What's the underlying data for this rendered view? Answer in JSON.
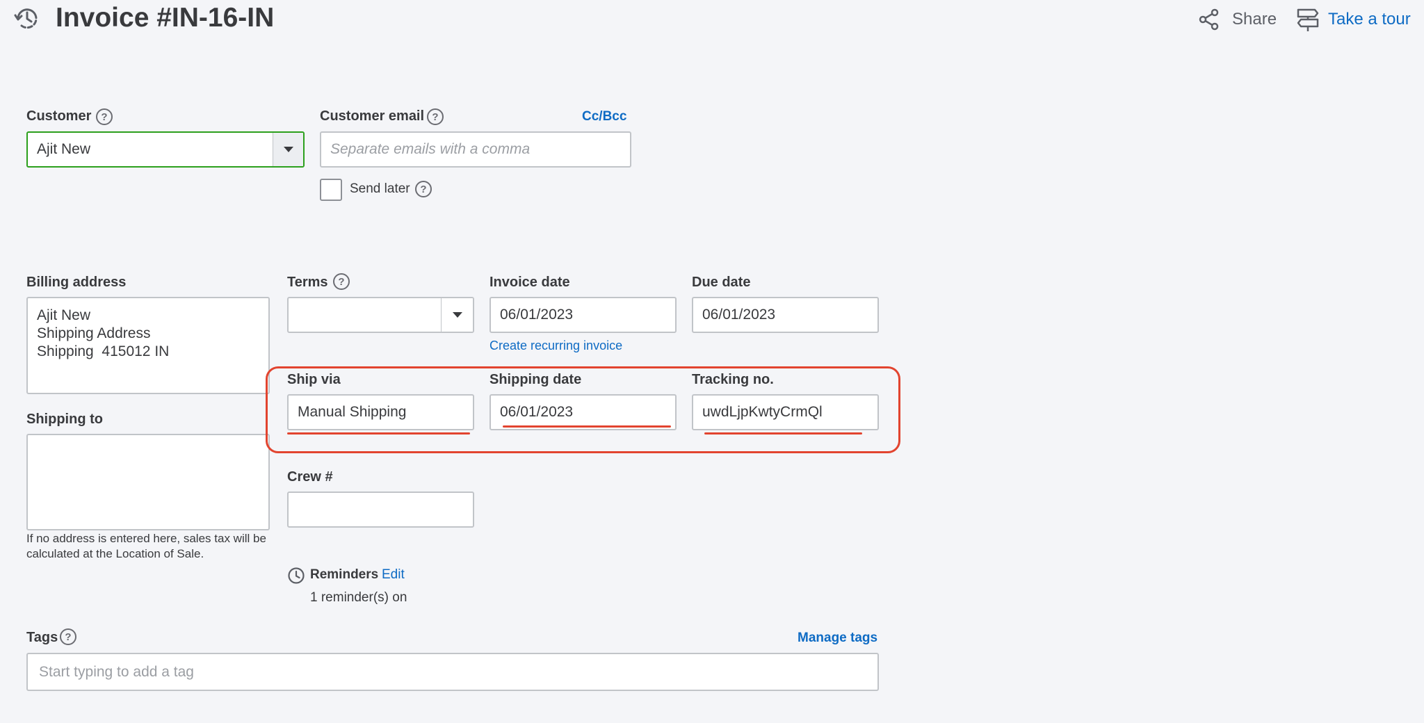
{
  "header": {
    "title": "Invoice #IN-16-IN",
    "share_label": "Share",
    "tour_label": "Take a tour"
  },
  "customer": {
    "label": "Customer",
    "value": "Ajit New"
  },
  "customer_email": {
    "label": "Customer email",
    "placeholder": "Separate emails with a comma",
    "cc_bcc": "Cc/Bcc",
    "send_later": "Send later"
  },
  "billing": {
    "label": "Billing address",
    "lines": [
      "Ajit New",
      "Shipping Address",
      "Shipping  415012 IN"
    ]
  },
  "shipping_to": {
    "label": "Shipping to",
    "note_line1": "If no address is entered here, sales tax will be",
    "note_line2": "calculated at the Location of Sale."
  },
  "terms": {
    "label": "Terms",
    "value": ""
  },
  "invoice_date": {
    "label": "Invoice date",
    "value": "06/01/2023",
    "recurring_link": "Create recurring invoice"
  },
  "due_date": {
    "label": "Due date",
    "value": "06/01/2023"
  },
  "ship_via": {
    "label": "Ship via",
    "value": "Manual Shipping"
  },
  "shipping_date": {
    "label": "Shipping date",
    "value": "06/01/2023"
  },
  "tracking": {
    "label": "Tracking no.",
    "value": "uwdLjpKwtyCrmQl"
  },
  "crew": {
    "label": "Crew #",
    "value": ""
  },
  "reminders": {
    "label": "Reminders",
    "edit": "Edit",
    "status": "1 reminder(s) on"
  },
  "tags": {
    "label": "Tags",
    "manage": "Manage tags",
    "placeholder": "Start typing to add a tag"
  },
  "colors": {
    "accent": "#0e6bc4",
    "highlight": "#e2442f",
    "active_border": "#2ca01c"
  },
  "icons": {
    "history": "history-icon",
    "share": "share-icon",
    "tour": "signpost-icon",
    "clock": "clock-icon"
  }
}
